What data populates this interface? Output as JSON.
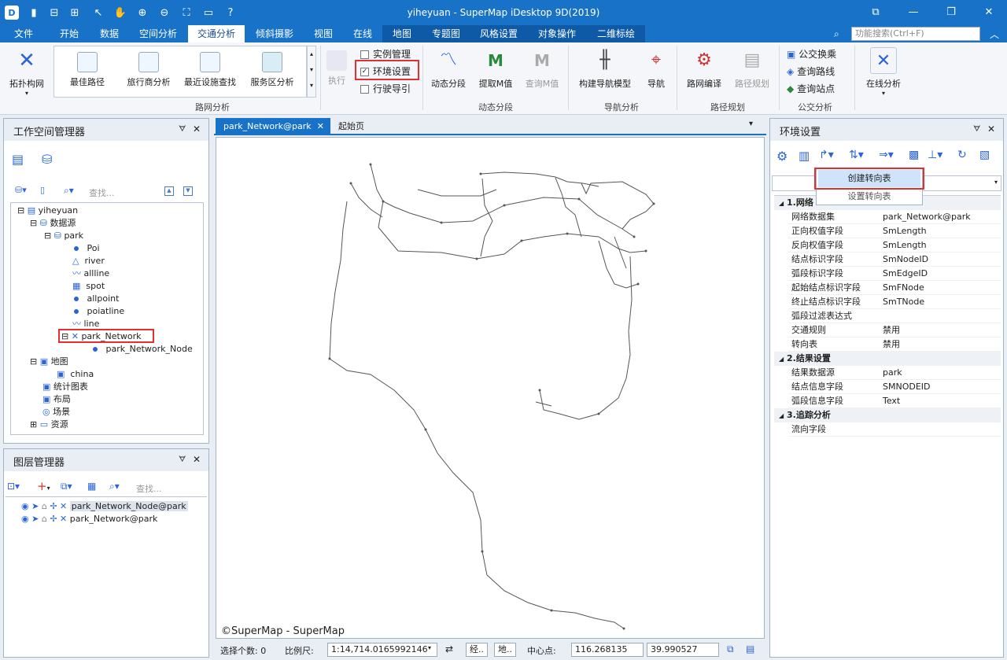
{
  "window": {
    "title": "yiheyuan - SuperMap iDesktop 9D(2019)"
  },
  "menu": [
    "文件",
    "开始",
    "数据",
    "空间分析",
    "交通分析",
    "倾斜摄影",
    "视图",
    "在线",
    "地图",
    "专题图",
    "风格设置",
    "对象操作",
    "二维标绘"
  ],
  "search_placeholder": "功能搜索(Ctrl+F)",
  "ribbon": {
    "topology": "拓扑构网",
    "gallery": [
      "最佳路径",
      "旅行商分析",
      "最近设施查找",
      "服务区分析"
    ],
    "group1": "路网分析",
    "execute": "执行",
    "checks": [
      "实例管理",
      "环境设置",
      "行驶导引"
    ],
    "dynseg": [
      "动态分段",
      "提取M值",
      "查询M值"
    ],
    "group2": "动态分段",
    "nav": [
      "构建导航模型",
      "导航"
    ],
    "group3": "导航分析",
    "route": [
      "路网编译",
      "路径规划"
    ],
    "group4": "路径规划",
    "transit": [
      "公交换乘",
      "查询路线",
      "查询站点"
    ],
    "group5": "公交分析",
    "online": "在线分析"
  },
  "workspace": {
    "title": "工作空间管理器",
    "search_placeholder": "查找...",
    "root": "yiheyuan",
    "datasources": "数据源",
    "park": "park",
    "datasets": [
      "Poi",
      "river",
      "allline",
      "spot",
      "allpoint",
      "poiatline",
      "line",
      "park_Network",
      "park_Network_Node"
    ],
    "maps": "地图",
    "china": "china",
    "others": [
      "统计图表",
      "布局",
      "场景",
      "资源"
    ]
  },
  "layers": {
    "title": "图层管理器",
    "search_placeholder": "查找...",
    "items": [
      "park_Network_Node@park",
      "park_Network@park"
    ]
  },
  "tabs": [
    "park_Network@park",
    "起始页"
  ],
  "map_credit": "©SuperMap - SuperMap",
  "env": {
    "title": "环境设置",
    "dropdown": [
      "创建转向表",
      "设置转向表"
    ],
    "group1": "1.网络",
    "rows1": [
      [
        "网络数据集",
        "park_Network@park"
      ],
      [
        "正向权值字段",
        "SmLength"
      ],
      [
        "反向权值字段",
        "SmLength"
      ],
      [
        "结点标识字段",
        "SmNodeID"
      ],
      [
        "弧段标识字段",
        "SmEdgeID"
      ],
      [
        "起始结点标识字段",
        "SmFNode"
      ],
      [
        "终止结点标识字段",
        "SmTNode"
      ],
      [
        "弧段过滤表达式",
        ""
      ],
      [
        "交通规则",
        "禁用"
      ],
      [
        "转向表",
        "禁用"
      ]
    ],
    "group2": "2.结果设置",
    "rows2": [
      [
        "结果数据源",
        "park"
      ],
      [
        "结点信息字段",
        "SMNODEID"
      ],
      [
        "弧段信息字段",
        "Text"
      ]
    ],
    "group3": "3.追踪分析",
    "rows3": [
      [
        "流向字段",
        ""
      ]
    ]
  },
  "status": {
    "sel_label": "选择个数: 0",
    "scale_label": "比例尺:",
    "scale": "1:14,714.0165992146",
    "b1": "经..",
    "b2": "地..",
    "center_label": "中心点:",
    "x": "116.268135",
    "y": "39.990527"
  }
}
